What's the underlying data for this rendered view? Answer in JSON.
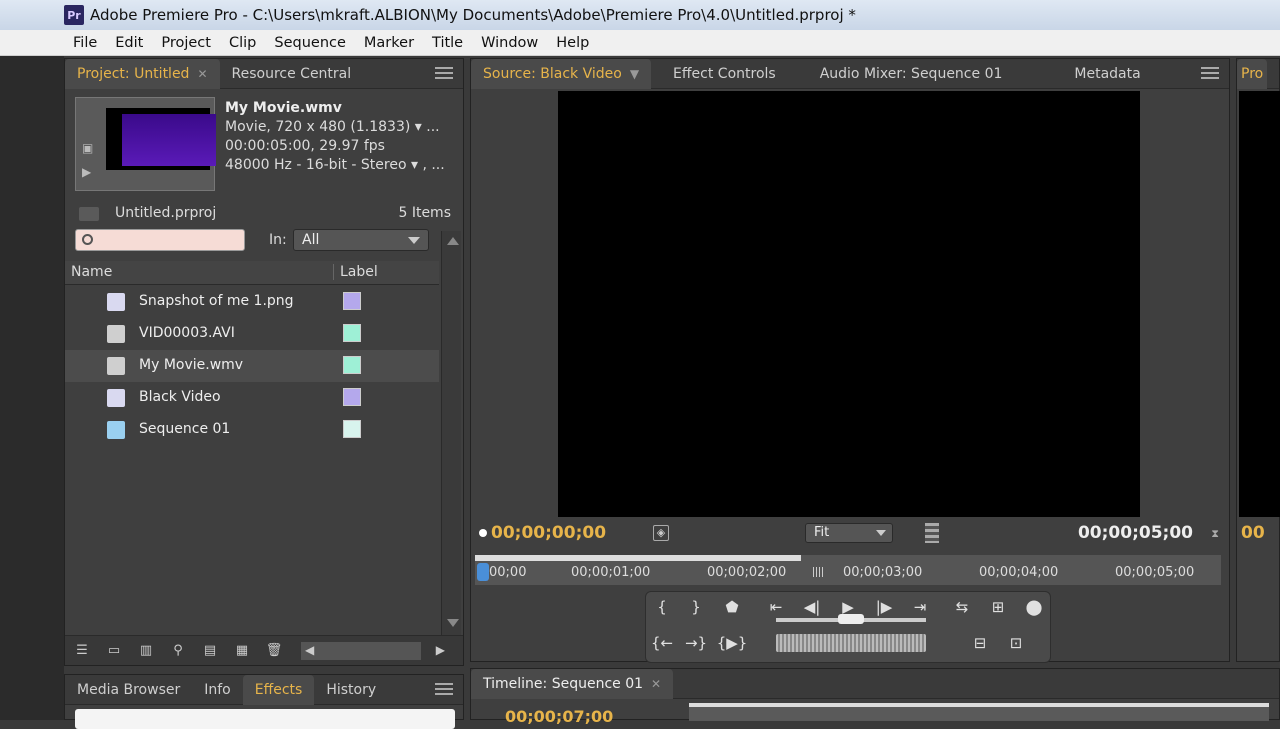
{
  "window": {
    "app_icon": "Pr",
    "title": "Adobe Premiere Pro - C:\\Users\\mkraft.ALBION\\My Documents\\Adobe\\Premiere Pro\\4.0\\Untitled.prproj *"
  },
  "menu": [
    "File",
    "Edit",
    "Project",
    "Clip",
    "Sequence",
    "Marker",
    "Title",
    "Window",
    "Help"
  ],
  "project_panel": {
    "tabs": [
      {
        "label": "Project: Untitled",
        "active": true,
        "highlighted": true
      },
      {
        "label": "Resource Central",
        "active": false
      }
    ],
    "clip_info": {
      "name": "My Movie.wmv",
      "line1": "Movie, 720 x 480 (1.1833)",
      "line2": "00:00:05:00, 29.97 fps",
      "line3": "48000 Hz - 16-bit - Stereo"
    },
    "project_name": "Untitled.prproj",
    "items_count": "5 Items",
    "search_placeholder": "",
    "in_label": "In:",
    "in_value": "All",
    "columns": {
      "name": "Name",
      "label": "Label"
    },
    "items": [
      {
        "name": "Snapshot of me 1.png",
        "icon": "image-icon",
        "color": "#b4a8ec",
        "selected": false
      },
      {
        "name": "VID00003.AVI",
        "icon": "movie-icon",
        "color": "#9ef0d6",
        "selected": false
      },
      {
        "name": "My Movie.wmv",
        "icon": "movie-icon",
        "color": "#9ef0d6",
        "selected": true
      },
      {
        "name": "Black Video",
        "icon": "image-icon",
        "color": "#b4a8ec",
        "selected": false
      },
      {
        "name": "Sequence 01",
        "icon": "sequence-icon",
        "color": "#d8f4ee",
        "selected": false
      }
    ]
  },
  "source_panel": {
    "tabs": [
      {
        "label": "Source: Black Video",
        "active": true,
        "highlighted": true
      },
      {
        "label": "Effect Controls",
        "active": false
      },
      {
        "label": "Audio Mixer: Sequence 01",
        "active": false
      },
      {
        "label": "Metadata",
        "active": false
      }
    ],
    "current_time": "00;00;00;00",
    "zoom": "Fit",
    "duration": "00;00;05;00",
    "ruler": [
      "00;00",
      "00;00;01;00",
      "00;00;02;00",
      "00;00;03;00",
      "00;00;04;00",
      "00;00;05;00"
    ]
  },
  "program_panel": {
    "tab": "Pro",
    "time_fragment": "00"
  },
  "bottom_panel": {
    "tabs": [
      {
        "label": "Media Browser",
        "active": false
      },
      {
        "label": "Info",
        "active": false
      },
      {
        "label": "Effects",
        "active": true,
        "highlighted": true
      },
      {
        "label": "History",
        "active": false
      }
    ]
  },
  "timeline_panel": {
    "tab": "Timeline: Sequence 01",
    "current_time": "00;00;07;00"
  }
}
